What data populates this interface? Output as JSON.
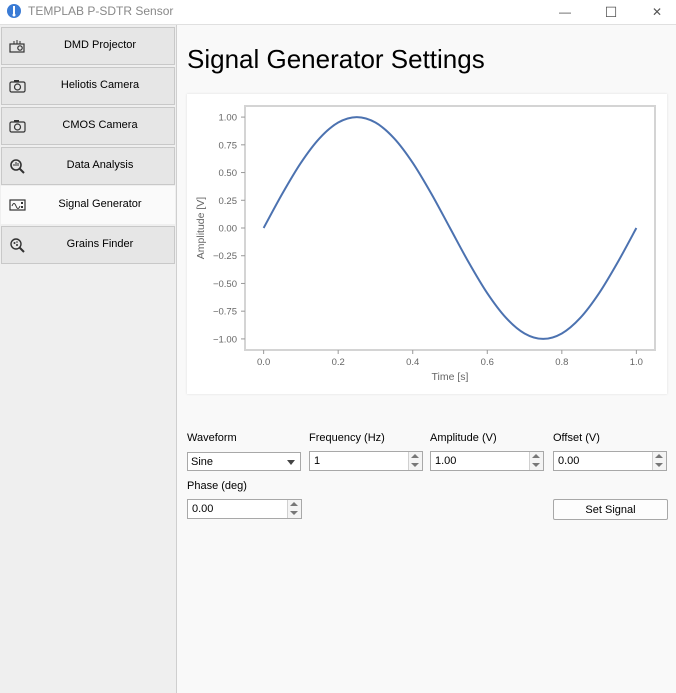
{
  "window": {
    "title": "TEMPLAB P-SDTR Sensor",
    "controls": {
      "minimize": "—",
      "maximize": "☐",
      "close": "✕"
    }
  },
  "sidebar": {
    "items": [
      {
        "label": "DMD Projector",
        "icon": "projector-icon"
      },
      {
        "label": "Heliotis Camera",
        "icon": "camera-icon"
      },
      {
        "label": "CMOS Camera",
        "icon": "camera-icon"
      },
      {
        "label": "Data Analysis",
        "icon": "magnifier-chart-icon"
      },
      {
        "label": "Signal Generator",
        "icon": "signal-generator-icon",
        "active": true
      },
      {
        "label": "Grains Finder",
        "icon": "grains-search-icon"
      }
    ]
  },
  "main": {
    "title": "Signal Generator Settings",
    "form": {
      "waveform": {
        "label": "Waveform",
        "value": "Sine"
      },
      "frequency": {
        "label": "Frequency (Hz)",
        "value": "1"
      },
      "amplitude": {
        "label": "Amplitude (V)",
        "value": "1.00"
      },
      "offset": {
        "label": "Offset (V)",
        "value": "0.00"
      },
      "phase": {
        "label": "Phase (deg)",
        "value": "0.00"
      },
      "set_button": "Set Signal"
    }
  },
  "chart_data": {
    "type": "line",
    "xlabel": "Time [s]",
    "ylabel": "Amplitude [V]",
    "xlim": [
      -0.05,
      1.05
    ],
    "ylim": [
      -1.1,
      1.1
    ],
    "xticks": [
      0.0,
      0.2,
      0.4,
      0.6,
      0.8,
      1.0
    ],
    "xtick_labels": [
      "0.0",
      "0.2",
      "0.4",
      "0.6",
      "0.8",
      "1.0"
    ],
    "yticks": [
      1.0,
      0.75,
      0.5,
      0.25,
      0.0,
      -0.25,
      -0.5,
      -0.75,
      -1.0
    ],
    "ytick_labels": [
      "1.00",
      "0.75",
      "0.50",
      "0.25",
      "0.00",
      "−0.25",
      "−0.50",
      "−0.75",
      "−1.00"
    ],
    "line_color": "#4c72b0",
    "grid": false,
    "series": [
      {
        "x": [
          0.0,
          0.05,
          0.1,
          0.15,
          0.2,
          0.25,
          0.3,
          0.35,
          0.4,
          0.45,
          0.5,
          0.55,
          0.6,
          0.65,
          0.7,
          0.75,
          0.8,
          0.85,
          0.9,
          0.95,
          1.0
        ],
        "y": [
          0.0,
          0.309,
          0.588,
          0.809,
          0.951,
          1.0,
          0.951,
          0.809,
          0.588,
          0.309,
          0.0,
          -0.309,
          -0.588,
          -0.809,
          -0.951,
          -1.0,
          -0.951,
          -0.809,
          -0.588,
          -0.309,
          0.0
        ]
      }
    ]
  }
}
